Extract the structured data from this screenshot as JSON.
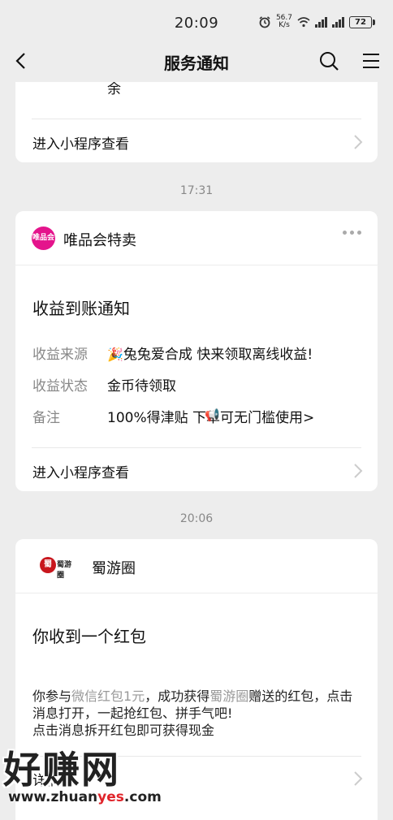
{
  "status_bar": {
    "time": "20:09",
    "speed_value": "56.7",
    "speed_unit": "K/s",
    "battery": "72"
  },
  "nav": {
    "title": "服务通知"
  },
  "card_partial": {
    "cut_text": "余",
    "action_label": "进入小程序查看"
  },
  "time_1": "17:31",
  "card_vip": {
    "logo_text": "唯品会",
    "brand": "唯品会特卖",
    "title": "收益到账通知",
    "rows": [
      {
        "label": "收益来源",
        "value": "兔兔爱合成 快来领取离线收益!"
      },
      {
        "label": "收益状态",
        "value": "金币待领取"
      },
      {
        "label": "备注",
        "value": "100%得津贴  下单可无门槛使用>"
      }
    ],
    "action_label": "进入小程序查看"
  },
  "time_2": "20:06",
  "card_shu": {
    "logo_text": "蜀游圈",
    "brand": "蜀游圈",
    "title": "你收到一个红包",
    "body_part1": "你参与",
    "body_hl1": "微信红包1元",
    "body_part2": "，成功获得",
    "body_hl2": "蜀游圈",
    "body_part3": "赠送的红包，点击消息打开，一起抢红包、拼手气吧!",
    "body_line3": "点击消息拆开红包即可获得现金",
    "action_label": "详情"
  },
  "watermark": {
    "main": "好赚网",
    "url_a": "www.zhuan",
    "url_b": "yes",
    "url_c": ".com"
  }
}
